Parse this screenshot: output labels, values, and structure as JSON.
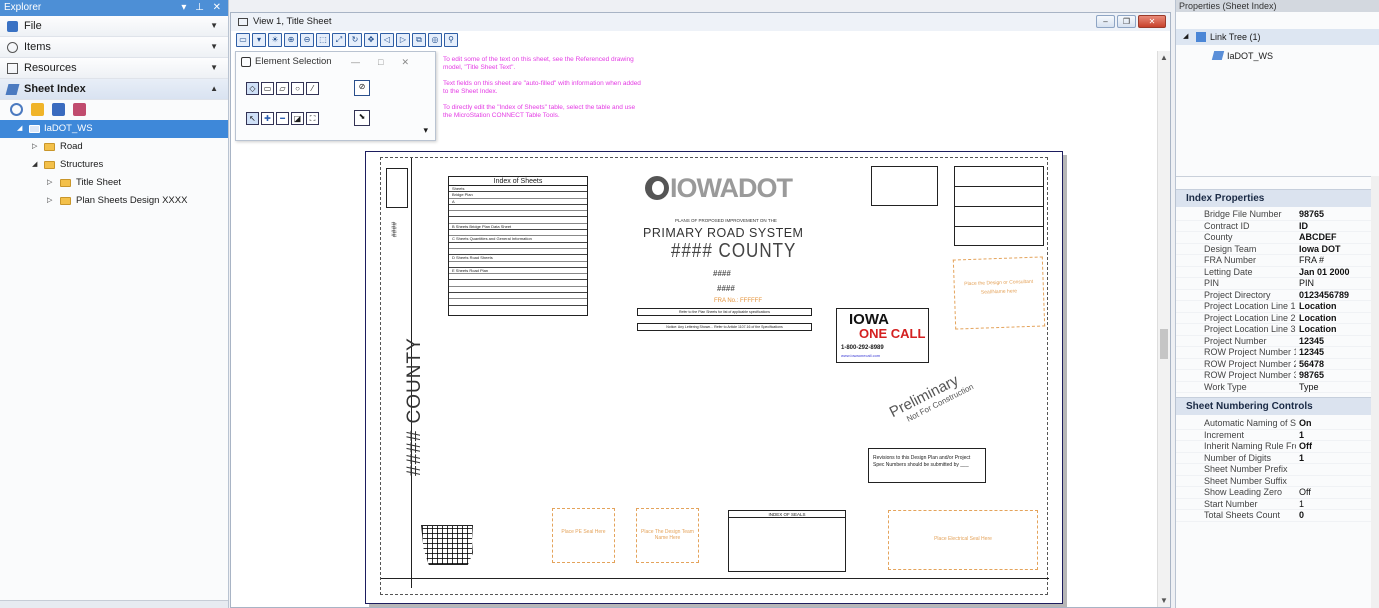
{
  "explorer": {
    "title": "Explorer",
    "title_controls": "▾ ⊥ ✕",
    "sections": [
      {
        "label": "File",
        "icon": "file-icon",
        "expanded": false
      },
      {
        "label": "Items",
        "icon": "items-icon",
        "expanded": false
      },
      {
        "label": "Resources",
        "icon": "resources-icon",
        "expanded": false
      },
      {
        "label": "Sheet Index",
        "icon": "sheet-index-icon",
        "expanded": true
      }
    ],
    "tree": {
      "root": "IaDOT_WS",
      "road": "Road",
      "structures": "Structures",
      "title_sheet": "Title Sheet",
      "plan_sheets": "Plan Sheets Design XXXX"
    }
  },
  "view": {
    "title": "View 1, Title Sheet",
    "element_selection": {
      "title": "Element Selection",
      "minimize": "—",
      "maximize": "□",
      "close": "✕"
    },
    "notes": [
      "To edit some of the text on this sheet, see the Referenced drawing model, \"Title Sheet Text\".",
      "Text fields on this sheet are \"auto-filled\" with information when added to the Sheet Index.",
      "To directly edit the \"Index of Sheets\" table, select the table and use the MicroStation CONNECT Table Tools."
    ],
    "sheet": {
      "index_title": "Index of Sheets",
      "index_rows": [
        "Sheets",
        "Bridge Plan",
        "A",
        "",
        "",
        "",
        "B Sheets  Bridge Plan Data Sheet",
        "",
        "C Sheets  Quantities and General Information",
        "",
        "",
        "D Sheets  Road Sheets",
        "",
        "E Sheets  Road Plan",
        "",
        "",
        "",
        "",
        ""
      ],
      "logo_text": "IOWADOT",
      "subtitle": "PLANS OF PROPOSED IMPROVEMENT ON THE",
      "primary": "PRIMARY ROAD SYSTEM",
      "county_line": "#### COUNTY",
      "hash1": "####",
      "hash2": "####",
      "fra": "FRA No.: FFFFFF",
      "note_box1": "Refer to the Plan Sheets for list of applicable specifications",
      "note_box2": "Notice: Any Lettering Shown... Refer to Article 1107.16 of the Specifications",
      "iowa": "IOWA",
      "one_call": "ONE CALL",
      "phone": "1-800-292-8989",
      "web": "www.iowaonecall.com",
      "prelim1": "Preliminary",
      "prelim2": "Not For Construction",
      "revisions": "Revisions to this Design Plan and/or Project Spec Numbers should be submitted by ___",
      "vertical_county": "#### COUNTY",
      "stamp1": "Place PE Seal Here",
      "stamp2": "Place The Design Team Name Here",
      "stamp3": "Place Electrical Seal Here",
      "stamp4": "Place the Design or Consultant Seal/Name here",
      "index_of_seals": "INDEX OF SEALS"
    }
  },
  "properties": {
    "title": "Properties (Sheet Index)",
    "link_tree": "Link Tree (1)",
    "link_child": "IaDOT_WS",
    "index_properties_title": "Index Properties",
    "index_properties": [
      {
        "k": "Bridge File Number",
        "v": "98765",
        "bold": true
      },
      {
        "k": "Contract ID",
        "v": "ID",
        "bold": true
      },
      {
        "k": "County",
        "v": "ABCDEF",
        "bold": true
      },
      {
        "k": "Design Team",
        "v": "Iowa DOT",
        "bold": true
      },
      {
        "k": "FRA Number",
        "v": "FRA #",
        "bold": false
      },
      {
        "k": "Letting Date",
        "v": "Jan 01 2000",
        "bold": true
      },
      {
        "k": "PIN",
        "v": "PIN",
        "bold": false
      },
      {
        "k": "Project Directory",
        "v": "0123456789",
        "bold": true
      },
      {
        "k": "Project Location Line 1",
        "v": "Location",
        "bold": true
      },
      {
        "k": "Project Location Line 2",
        "v": "Location",
        "bold": true
      },
      {
        "k": "Project Location Line 3",
        "v": "Location",
        "bold": true
      },
      {
        "k": "Project Number",
        "v": "12345",
        "bold": true
      },
      {
        "k": "ROW Project Number 1",
        "v": "12345",
        "bold": true
      },
      {
        "k": "ROW Project Number 2",
        "v": "56478",
        "bold": true
      },
      {
        "k": "ROW Project Number 3",
        "v": "98765",
        "bold": true
      },
      {
        "k": "Work Type",
        "v": "Type",
        "bold": false
      }
    ],
    "sheet_numbering_title": "Sheet Numbering Controls",
    "sheet_numbering": [
      {
        "k": "Automatic Naming of She",
        "v": "On",
        "bold": true
      },
      {
        "k": "Increment",
        "v": "1",
        "bold": true
      },
      {
        "k": "Inherit Naming Rule Fror",
        "v": "Off",
        "bold": true
      },
      {
        "k": "Number of Digits",
        "v": "1",
        "bold": true
      },
      {
        "k": "Sheet Number Prefix",
        "v": "",
        "bold": false
      },
      {
        "k": "Sheet Number Suffix",
        "v": "",
        "bold": false
      },
      {
        "k": "Show Leading Zero",
        "v": "Off",
        "bold": false
      },
      {
        "k": "Start Number",
        "v": "1",
        "bold": false
      },
      {
        "k": "Total Sheets Count",
        "v": "0",
        "bold": true
      }
    ]
  },
  "colors": {
    "accent": "#4d8fd6",
    "selected": "#3e88d9",
    "note_magenta": "#e43be4",
    "stamp_orange": "#e4a35b",
    "one_call_red": "#d42020"
  }
}
